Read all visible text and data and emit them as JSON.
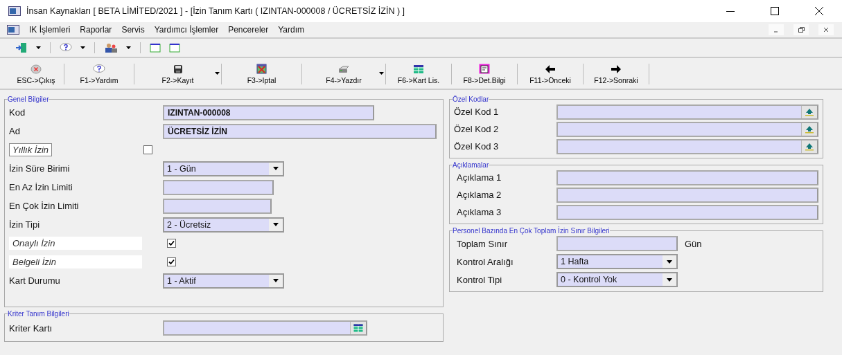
{
  "window": {
    "title": "İnsan Kaynakları [ BETA LİMİTED/2021 ]  - [İzin Tanım Kartı ( IZINTAN-000008 / ÜCRETSİZ İZİN ) ]"
  },
  "menu": [
    "IK İşlemleri",
    "Raporlar",
    "Servis",
    "Yardımcı İşlemler",
    "Pencereler",
    "Yardım"
  ],
  "small_toolbar": [
    {
      "kind": "exit",
      "dropdown": true
    },
    {
      "kind": "help",
      "dropdown": true
    },
    {
      "kind": "people",
      "dropdown": true
    },
    {
      "kind": "window",
      "dropdown": false
    },
    {
      "kind": "window",
      "dropdown": false
    }
  ],
  "toolbar": [
    {
      "kind": "close",
      "label": "ESC->Çıkış",
      "dropdown": false
    },
    {
      "kind": "help",
      "label": "F1->Yardım",
      "dropdown": false
    },
    {
      "kind": "save",
      "label": "F2->Kayıt",
      "dropdown": true
    },
    {
      "kind": "cancel",
      "label": "F3->Iptal",
      "dropdown": false
    },
    {
      "kind": "print",
      "label": "F4->Yazdır",
      "dropdown": true
    },
    {
      "kind": "list",
      "label": "F6->Kart Lis.",
      "dropdown": false
    },
    {
      "kind": "detail",
      "label": "F8->Det.Bilgi",
      "dropdown": false
    },
    {
      "kind": "prev",
      "label": "F11->Önceki",
      "dropdown": false
    },
    {
      "kind": "next",
      "label": "F12->Sonraki",
      "dropdown": false
    }
  ],
  "general": {
    "title": "Genel Bilgiler",
    "fields": [
      {
        "kind": "text",
        "label": "Kod",
        "value": "IZINTAN-000008"
      },
      {
        "kind": "text",
        "label": "Ad",
        "value": "ÜCRETSİZ İZİN"
      },
      {
        "kind": "check",
        "label": "Yıllık İzin",
        "checked": false,
        "focused": true
      },
      {
        "kind": "combo",
        "label": "İzin Süre Birimi",
        "value": "1 - Gün"
      },
      {
        "kind": "text",
        "label": "En Az İzin Limiti"
      },
      {
        "kind": "text",
        "label": "En Çok İzin Limiti"
      },
      {
        "kind": "combo",
        "label": "İzin Tipi",
        "value": "2 - Ücretsiz"
      },
      {
        "kind": "check",
        "label": "Onaylı İzin",
        "checked": true,
        "focused": false
      },
      {
        "kind": "check",
        "label": "Belgeli İzin",
        "checked": true,
        "focused": false
      },
      {
        "kind": "combo",
        "label": "Kart Durumu",
        "value": "1 - Aktif"
      }
    ]
  },
  "criteria": {
    "title": "Kriter Tanım Bilgileri",
    "fields": [
      {
        "kind": "lookup",
        "label": "Kriter Kartı"
      }
    ]
  },
  "special_codes": {
    "title": "Özel Kodlar",
    "fields": [
      {
        "kind": "picker",
        "label": "Özel Kod 1"
      },
      {
        "kind": "picker",
        "label": "Özel Kod 2"
      },
      {
        "kind": "picker",
        "label": "Özel Kod 3"
      }
    ]
  },
  "descriptions": {
    "title": "Açıklamalar",
    "fields": [
      {
        "kind": "text",
        "label": "Açıklama 1"
      },
      {
        "kind": "text",
        "label": "Açıklama 2"
      },
      {
        "kind": "text",
        "label": "Açıklama 3"
      }
    ]
  },
  "limits": {
    "title": "Personel Bazında En Çok Toplam İzin Sınır Bilgileri",
    "fields": [
      {
        "kind": "text",
        "label": "Toplam Sınır",
        "unit": "Gün"
      },
      {
        "kind": "combo",
        "label": "Kontrol Aralığı",
        "value": "1 Hafta"
      },
      {
        "kind": "combo",
        "label": "Kontrol Tipi",
        "value": "0 - Kontrol Yok"
      }
    ]
  }
}
